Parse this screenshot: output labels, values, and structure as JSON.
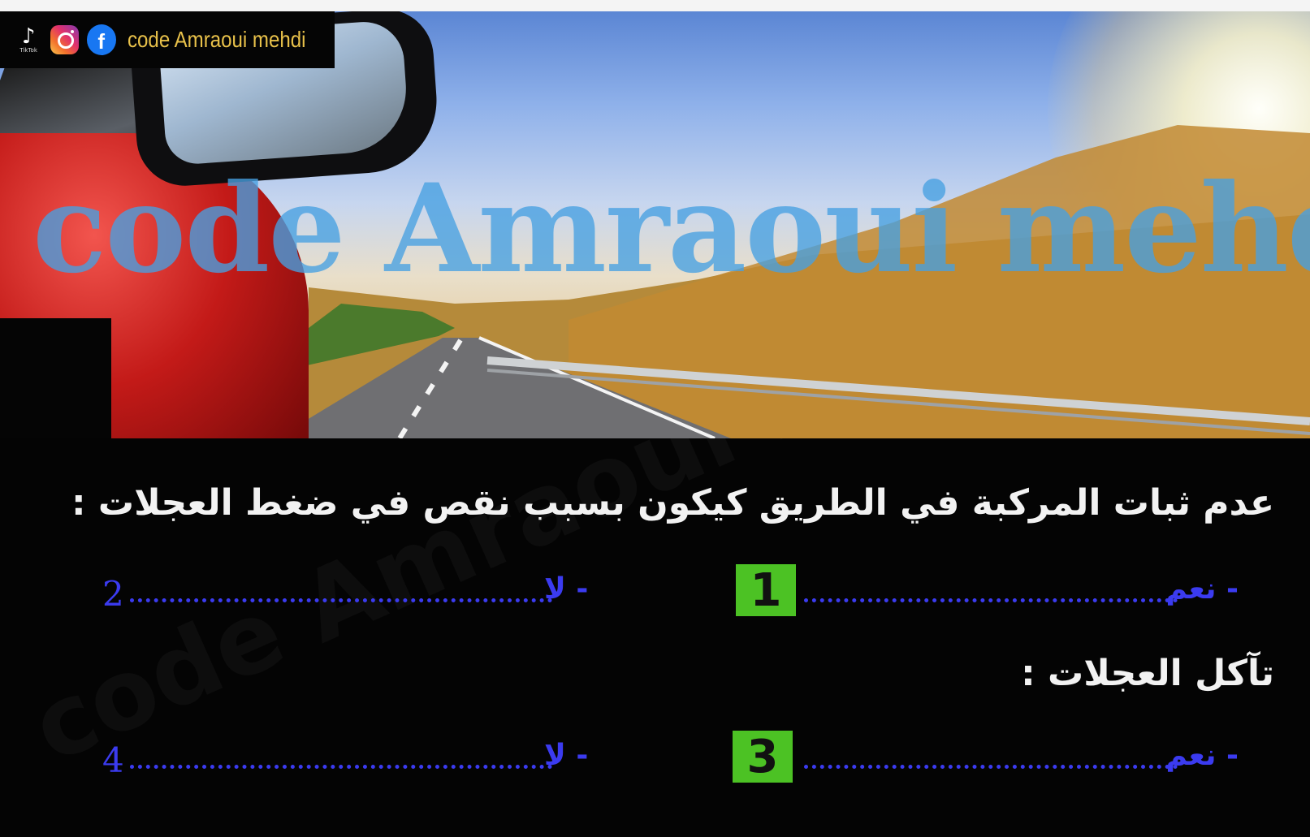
{
  "social": {
    "tiktok_icon": "tiktok-icon",
    "tiktok_tag": "TikTok",
    "instagram_icon": "instagram-icon",
    "facebook_icon": "facebook-icon",
    "facebook_glyph": "f",
    "channel_name": "code Amraoui mehdi"
  },
  "banner": {
    "watermark": "code Amraoui mehdi",
    "watermark_color": "#46a0e1"
  },
  "quiz": {
    "background_watermark": "code Amraoui mehdi",
    "questions": [
      {
        "text": "عدم ثبات المركبة في الطريق كيكون بسبب نقص  في ضغط العجلات :",
        "yes_label": "- نعم",
        "no_label": "- لا",
        "yes_number": "1",
        "no_number": "2"
      },
      {
        "text": "تآكل العجلات :",
        "yes_label": "- نعم",
        "no_label": "- لا",
        "yes_number": "3",
        "no_number": "4"
      }
    ],
    "colors": {
      "answer_text": "#3b3bf0",
      "number_box": "#4cc224",
      "question_text": "#f2f2f2"
    }
  }
}
